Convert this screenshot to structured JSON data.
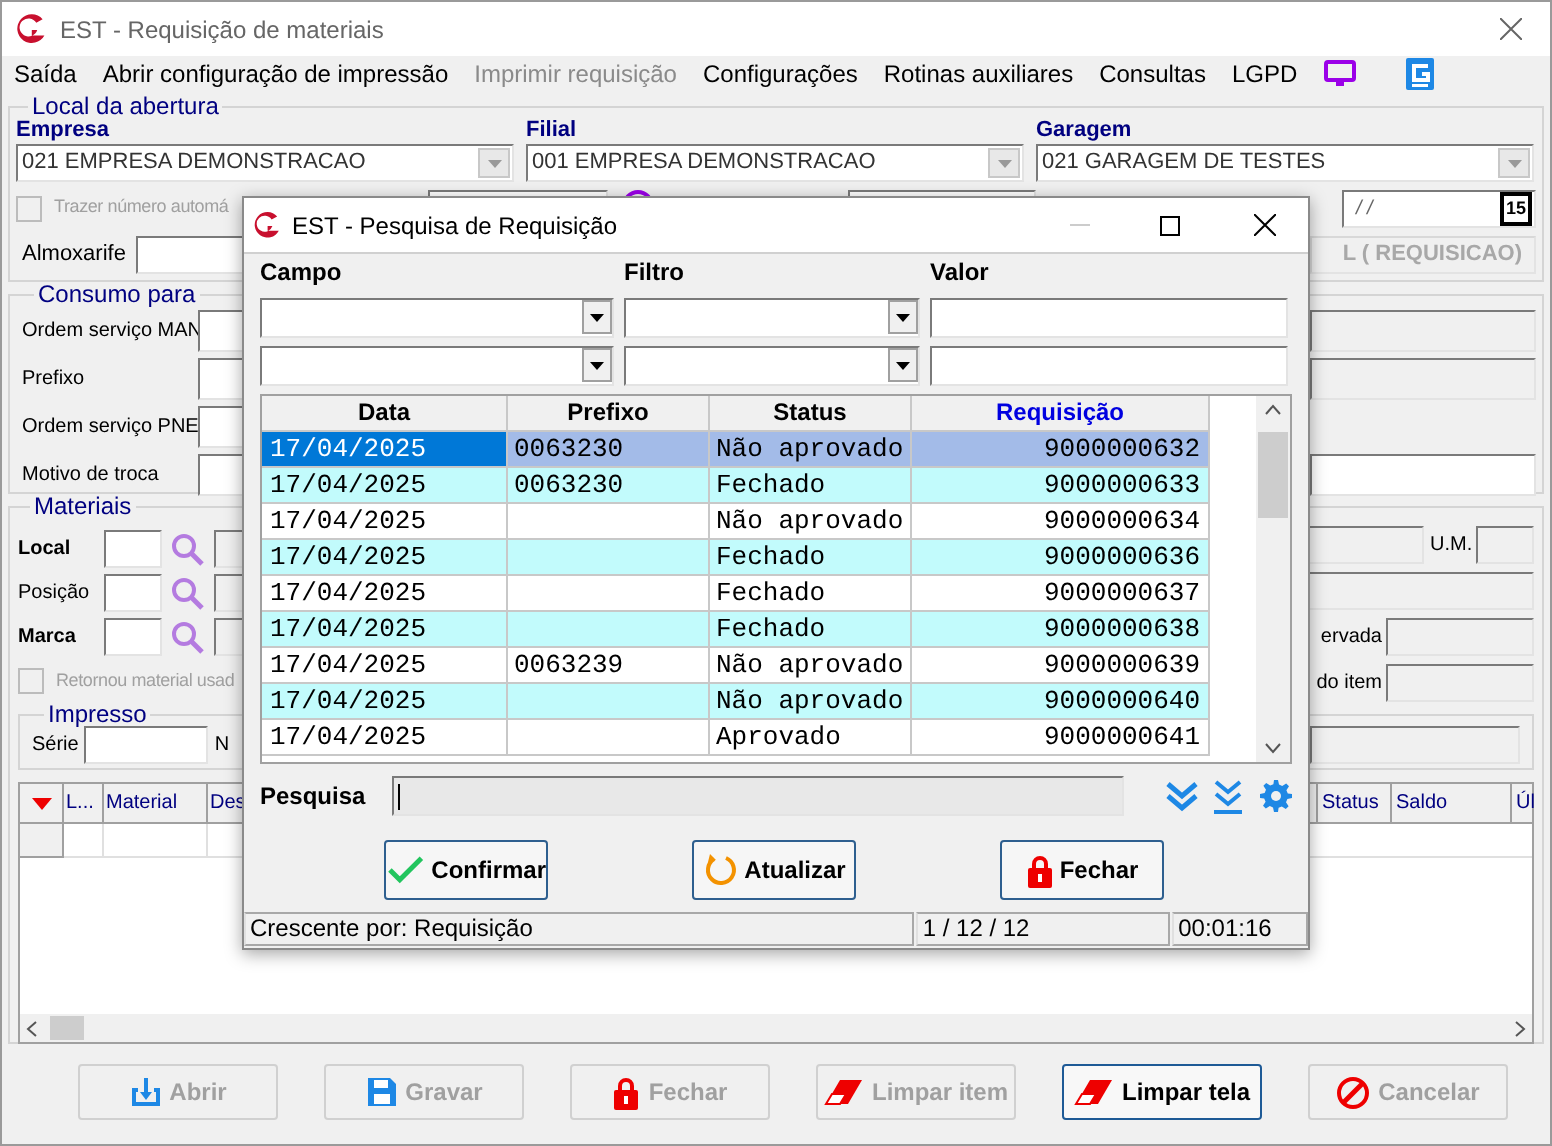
{
  "window": {
    "title": "EST - Requisição de materiais"
  },
  "menu": [
    {
      "label": "Saída",
      "disabled": false
    },
    {
      "label": "Abrir configuração de impressão",
      "disabled": false
    },
    {
      "label": "Imprimir requisição",
      "disabled": true
    },
    {
      "label": "Configurações",
      "disabled": false
    },
    {
      "label": "Rotinas auxiliares",
      "disabled": false
    },
    {
      "label": "Consultas",
      "disabled": false
    },
    {
      "label": "LGPD",
      "disabled": false
    }
  ],
  "local_da_abertura": {
    "title": "Local da abertura",
    "selects": [
      {
        "label": "Empresa",
        "value": "021 EMPRESA DEMONSTRACAO"
      },
      {
        "label": "Filial",
        "value": "001 EMPRESA DEMONSTRACAO"
      },
      {
        "label": "Garagem",
        "value": "021 GARAGEM DE TESTES"
      }
    ],
    "auto_number": {
      "label": "Trazer número automá",
      "checked": false
    },
    "date": {
      "value": "/ /",
      "calendar": "15"
    },
    "almoxarife_label": "Almoxarife",
    "banner": "L ( REQUISICAO)"
  },
  "consumo_para": {
    "title": "Consumo para",
    "labels": [
      "Ordem serviço MAN",
      "Prefixo",
      "Ordem serviço PNE",
      "Motivo de troca"
    ]
  },
  "materiais": {
    "title": "Materiais",
    "lookups": [
      {
        "label": "Local",
        "bold": true
      },
      {
        "label": "Posição",
        "bold": false
      },
      {
        "label": "Marca",
        "bold": true
      }
    ],
    "um_label": "U.M.",
    "reserved_label": "ervada",
    "item_label": "do item",
    "returned": {
      "label": "Retornou material usad",
      "checked": false
    },
    "impresso": {
      "title": "Impresso",
      "serie_label": "Série",
      "number_label": "N"
    }
  },
  "items_table": {
    "left_columns": [
      "L...",
      "Material",
      "Des"
    ],
    "right_columns": [
      "Status",
      "Saldo",
      "Úl"
    ]
  },
  "buttons": [
    {
      "label": "Abrir",
      "kind": "download",
      "disabled": true
    },
    {
      "label": "Gravar",
      "kind": "save",
      "disabled": true
    },
    {
      "label": "Fechar",
      "kind": "lock",
      "disabled": true
    },
    {
      "label": "Limpar item",
      "kind": "eraser",
      "disabled": true
    },
    {
      "label": "Limpar tela",
      "kind": "eraser",
      "disabled": false
    },
    {
      "label": "Cancelar",
      "kind": "cancel",
      "disabled": true
    }
  ],
  "dialog": {
    "title": "EST - Pesquisa de Requisição",
    "filter_labels": [
      "Campo",
      "Filtro",
      "Valor"
    ],
    "columns": [
      {
        "label": "Data",
        "sorted": false
      },
      {
        "label": "Prefixo",
        "sorted": false
      },
      {
        "label": "Status",
        "sorted": false
      },
      {
        "label": "Requisição",
        "sorted": true
      }
    ],
    "rows": [
      {
        "data": "17/04/2025",
        "prefixo": "0063230",
        "status": "Não aprovado",
        "requisicao": "9000000632",
        "selected": true
      },
      {
        "data": "17/04/2025",
        "prefixo": "0063230",
        "status": "Fechado",
        "requisicao": "9000000633",
        "selected": false
      },
      {
        "data": "17/04/2025",
        "prefixo": "",
        "status": "Não aprovado",
        "requisicao": "9000000634",
        "selected": false
      },
      {
        "data": "17/04/2025",
        "prefixo": "",
        "status": "Fechado",
        "requisicao": "9000000636",
        "selected": false
      },
      {
        "data": "17/04/2025",
        "prefixo": "",
        "status": "Fechado",
        "requisicao": "9000000637",
        "selected": false
      },
      {
        "data": "17/04/2025",
        "prefixo": "",
        "status": "Fechado",
        "requisicao": "9000000638",
        "selected": false
      },
      {
        "data": "17/04/2025",
        "prefixo": "0063239",
        "status": "Não aprovado",
        "requisicao": "9000000639",
        "selected": false
      },
      {
        "data": "17/04/2025",
        "prefixo": "",
        "status": "Não aprovado",
        "requisicao": "9000000640",
        "selected": false
      },
      {
        "data": "17/04/2025",
        "prefixo": "",
        "status": "Aprovado",
        "requisicao": "9000000641",
        "selected": false
      }
    ],
    "search_label": "Pesquisa",
    "buttons": [
      {
        "label": "Confirmar",
        "kind": "check"
      },
      {
        "label": "Atualizar",
        "kind": "refresh"
      },
      {
        "label": "Fechar",
        "kind": "lock"
      }
    ],
    "status_bar": [
      "Crescente por: Requisição",
      "1 / 12 / 12",
      "00:01:16"
    ]
  }
}
